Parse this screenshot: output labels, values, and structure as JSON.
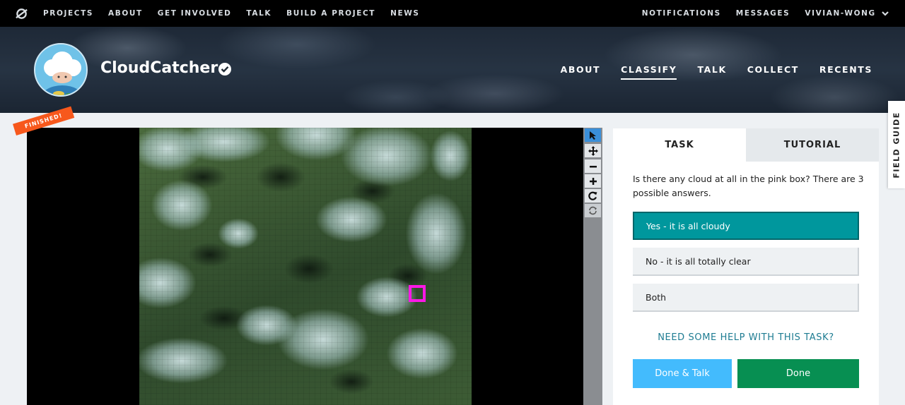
{
  "topnav": {
    "links": [
      "PROJECTS",
      "ABOUT",
      "GET INVOLVED",
      "TALK",
      "BUILD A PROJECT",
      "NEWS"
    ],
    "notifications": "NOTIFICATIONS",
    "messages": "MESSAGES",
    "user": "VIVIAN-WONG"
  },
  "project": {
    "title": "CloudCatcher",
    "nav": [
      "ABOUT",
      "CLASSIFY",
      "TALK",
      "COLLECT",
      "RECENTS"
    ],
    "active_nav": "CLASSIFY"
  },
  "viewer": {
    "ribbon": "FINISHED!",
    "tools": [
      "pointer-icon",
      "pan-icon",
      "zoom-out-icon",
      "zoom-in-icon",
      "rotate-icon",
      "reset-icon"
    ]
  },
  "task": {
    "tabs": [
      "TASK",
      "TUTORIAL"
    ],
    "question": "Is there any cloud at all in the pink box? There are 3 possible answers.",
    "answers": [
      "Yes - it is all cloudy",
      "No - it is all totally clear",
      "Both"
    ],
    "selected_answer": 0,
    "help": "NEED SOME HELP WITH THIS TASK?",
    "done_talk": "Done & Talk",
    "done": "Done"
  },
  "field_guide": "FIELD GUIDE",
  "colors": {
    "selected_answer": "#00979d",
    "done_talk": "#43bbfd",
    "done": "#078f52",
    "ribbon": "#f7581c",
    "pink_box": "#ff18e7"
  }
}
